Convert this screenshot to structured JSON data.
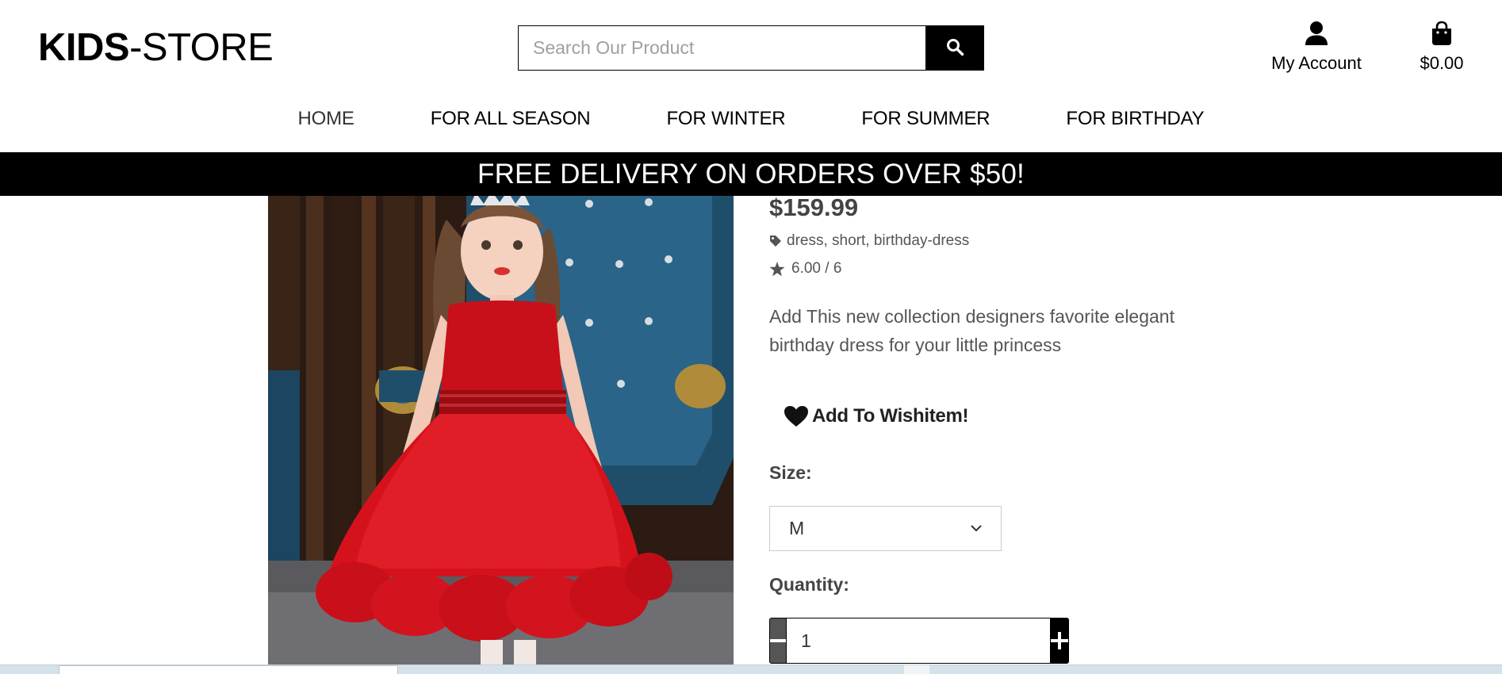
{
  "header": {
    "logo_bold": "KIDS",
    "logo_rest": "-STORE",
    "search": {
      "placeholder": "Search Our Product",
      "value": "",
      "icon": "search-icon"
    },
    "account": {
      "label": "My Account",
      "icon": "user-icon"
    },
    "cart": {
      "label": "$0.00",
      "icon": "shopping-bag-icon"
    }
  },
  "nav": {
    "items": [
      {
        "label": "HOME"
      },
      {
        "label": "FOR ALL SEASON"
      },
      {
        "label": "FOR WINTER"
      },
      {
        "label": "FOR SUMMER"
      },
      {
        "label": "FOR BIRTHDAY"
      }
    ]
  },
  "banner": {
    "text": "FREE DELIVERY ON ORDERS OVER $50!"
  },
  "product": {
    "price": "$159.99",
    "tags": [
      "dress",
      "short",
      "birthday-dress"
    ],
    "tag_separator": ", ",
    "rating": "6.00 / 6",
    "description": "Add This new collection designers favorite elegant birthday dress for your little princess",
    "wishlist_label": "Add To Wishitem!",
    "size_label": "Size:",
    "size_value": "M",
    "quantity_label": "Quantity:",
    "quantity_value": "1"
  },
  "colors": {
    "accent": "#000000",
    "text_muted": "#555555",
    "dress_red": "#c8101a",
    "chair_blue": "#1f4e6b"
  }
}
